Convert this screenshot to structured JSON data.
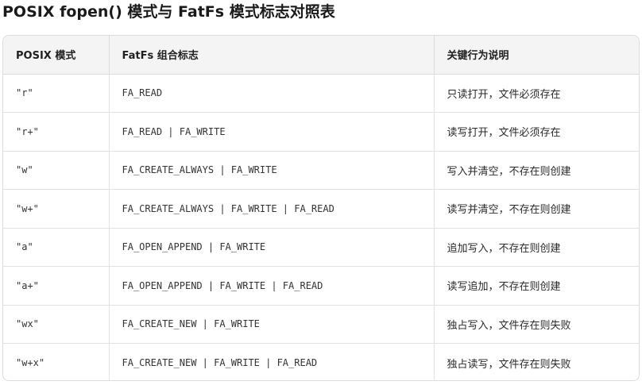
{
  "title": "POSIX fopen() 模式与 FatFs 模式标志对照表",
  "table": {
    "headers": [
      "POSIX 模式",
      "FatFs 组合标志",
      "关键行为说明"
    ],
    "rows": [
      {
        "mode": "\"r\"",
        "flags": "FA_READ",
        "desc": "只读打开，文件必须存在"
      },
      {
        "mode": "\"r+\"",
        "flags": "FA_READ | FA_WRITE",
        "desc": "读写打开，文件必须存在"
      },
      {
        "mode": "\"w\"",
        "flags": "FA_CREATE_ALWAYS | FA_WRITE",
        "desc": "写入并清空，不存在则创建"
      },
      {
        "mode": "\"w+\"",
        "flags": "FA_CREATE_ALWAYS | FA_WRITE | FA_READ",
        "desc": "读写并清空，不存在则创建"
      },
      {
        "mode": "\"a\"",
        "flags": "FA_OPEN_APPEND | FA_WRITE",
        "desc": "追加写入，不存在则创建"
      },
      {
        "mode": "\"a+\"",
        "flags": "FA_OPEN_APPEND | FA_WRITE | FA_READ",
        "desc": "读写追加，不存在则创建"
      },
      {
        "mode": "\"wx\"",
        "flags": "FA_CREATE_NEW | FA_WRITE",
        "desc": "独占写入，文件存在则失败"
      },
      {
        "mode": "\"w+x\"",
        "flags": "FA_CREATE_NEW | FA_WRITE | FA_READ",
        "desc": "独占读写，文件存在则失败"
      }
    ]
  }
}
